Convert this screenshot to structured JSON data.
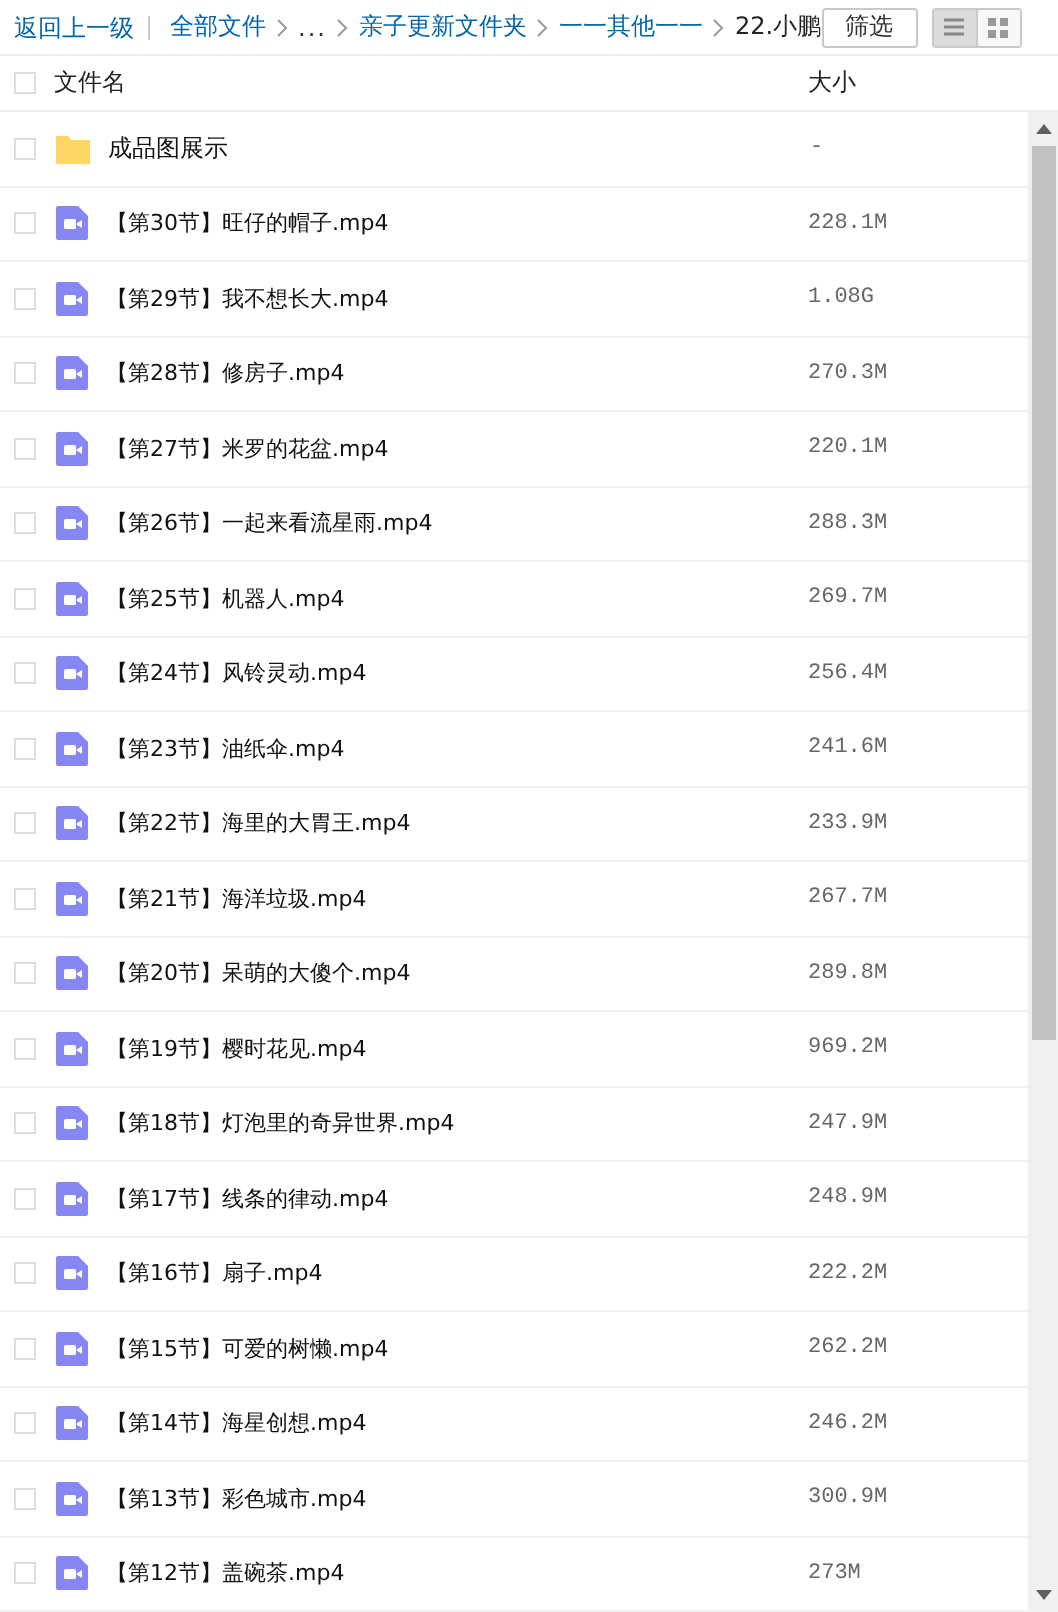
{
  "toolbar": {
    "back": "返回上一级",
    "breadcrumbs": [
      {
        "kind": "link",
        "label": "全部文件"
      },
      {
        "kind": "ellipsis",
        "label": "..."
      },
      {
        "kind": "link",
        "label": "亲子更新文件夹"
      },
      {
        "kind": "link",
        "label": "一一其他一一"
      },
      {
        "kind": "current",
        "label": "22.小鹏"
      }
    ],
    "filter_button": "筛选",
    "view_modes": [
      {
        "kind": "list",
        "selected": true
      },
      {
        "kind": "grid",
        "selected": false
      }
    ]
  },
  "table": {
    "select_all": {
      "checked": false
    },
    "columns": [
      "文件名",
      "大小"
    ],
    "rows": [
      {
        "kind": "folder",
        "name": "成品图展示",
        "size": "-",
        "checked": false
      },
      {
        "kind": "video",
        "name": "【第30节】旺仔的帽子.mp4",
        "size": "228.1M",
        "checked": false
      },
      {
        "kind": "video",
        "name": "【第29节】我不想长大.mp4",
        "size": "1.08G",
        "checked": false
      },
      {
        "kind": "video",
        "name": "【第28节】修房子.mp4",
        "size": "270.3M",
        "checked": false
      },
      {
        "kind": "video",
        "name": "【第27节】米罗的花盆.mp4",
        "size": "220.1M",
        "checked": false
      },
      {
        "kind": "video",
        "name": "【第26节】一起来看流星雨.mp4",
        "size": "288.3M",
        "checked": false
      },
      {
        "kind": "video",
        "name": "【第25节】机器人.mp4",
        "size": "269.7M",
        "checked": false
      },
      {
        "kind": "video",
        "name": "【第24节】风铃灵动.mp4",
        "size": "256.4M",
        "checked": false
      },
      {
        "kind": "video",
        "name": "【第23节】油纸伞.mp4",
        "size": "241.6M",
        "checked": false
      },
      {
        "kind": "video",
        "name": "【第22节】海里的大胃王.mp4",
        "size": "233.9M",
        "checked": false
      },
      {
        "kind": "video",
        "name": "【第21节】海洋垃圾.mp4",
        "size": "267.7M",
        "checked": false
      },
      {
        "kind": "video",
        "name": "【第20节】呆萌的大傻个.mp4",
        "size": "289.8M",
        "checked": false
      },
      {
        "kind": "video",
        "name": "【第19节】樱时花见.mp4",
        "size": "969.2M",
        "checked": false
      },
      {
        "kind": "video",
        "name": "【第18节】灯泡里的奇异世界.mp4",
        "size": "247.9M",
        "checked": false
      },
      {
        "kind": "video",
        "name": "【第17节】线条的律动.mp4",
        "size": "248.9M",
        "checked": false
      },
      {
        "kind": "video",
        "name": "【第16节】扇子.mp4",
        "size": "222.2M",
        "checked": false
      },
      {
        "kind": "video",
        "name": "【第15节】可爱的树懒.mp4",
        "size": "262.2M",
        "checked": false
      },
      {
        "kind": "video",
        "name": "【第14节】海星创想.mp4",
        "size": "246.2M",
        "checked": false
      },
      {
        "kind": "video",
        "name": "【第13节】彩色城市.mp4",
        "size": "300.9M",
        "checked": false
      },
      {
        "kind": "video",
        "name": "【第12节】盖碗茶.mp4",
        "size": "273M",
        "checked": false
      }
    ]
  }
}
